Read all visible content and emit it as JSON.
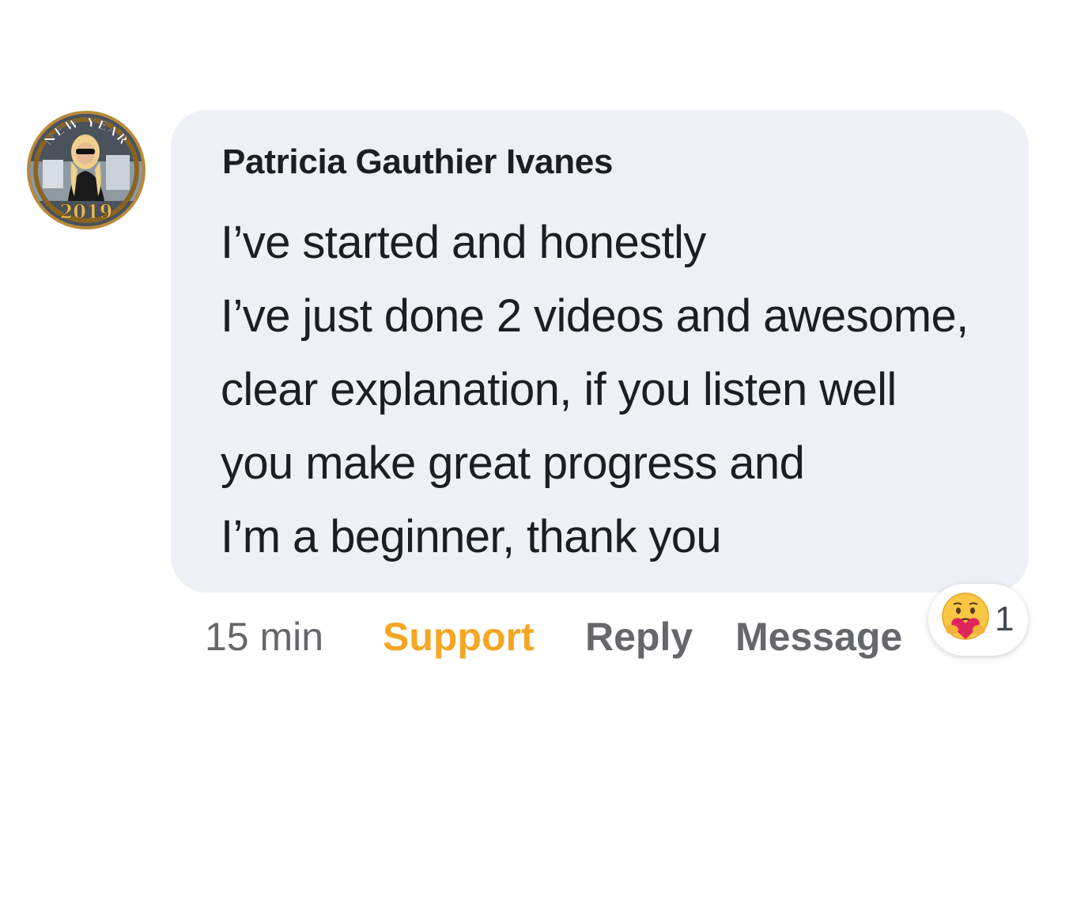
{
  "comment": {
    "author": "Patricia Gauthier Ivanes",
    "avatar": {
      "badge_top": "NEW YEAR",
      "badge_bottom": "2019"
    },
    "text_lines": [
      "I’ve started and honestly",
      "I’ve just done 2 videos and awesome,",
      "clear explanation, if you listen well",
      "you make great progress and",
      "I’m a beginner, thank you"
    ],
    "timestamp": "15 min",
    "actions": {
      "support_label": "Support",
      "reply_label": "Reply",
      "message_label": "Message"
    },
    "reaction": {
      "icon": "care-emoji-icon",
      "count": "1"
    }
  },
  "colors": {
    "bubble_background": "#eef0f5",
    "support_accent": "#f5a623",
    "secondary_text": "#65676b",
    "primary_text": "#1c1e21"
  }
}
